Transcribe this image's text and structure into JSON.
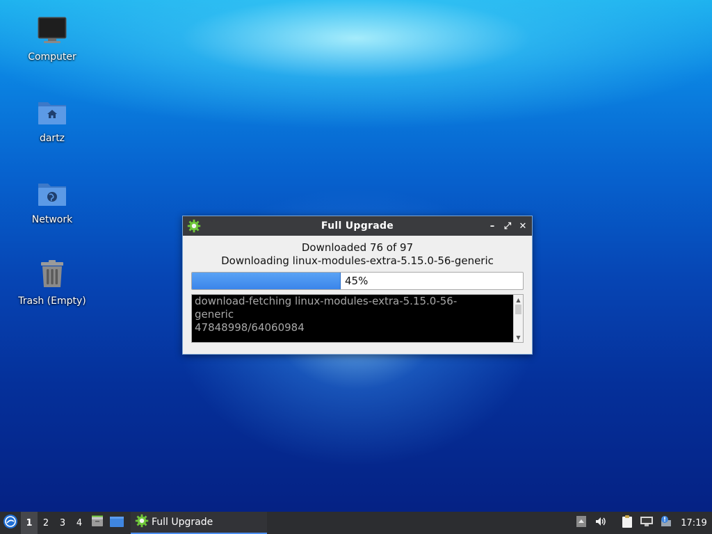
{
  "desktop": {
    "icons": [
      {
        "label": "Computer",
        "icon": "computer-icon"
      },
      {
        "label": "dartz",
        "icon": "home-folder-icon"
      },
      {
        "label": "Network",
        "icon": "network-folder-icon"
      },
      {
        "label": "Trash (Empty)",
        "icon": "trash-icon"
      }
    ]
  },
  "dialog": {
    "title": "Full Upgrade",
    "status_line1": "Downloaded 76 of 97",
    "status_line2": "Downloading linux-modules-extra-5.15.0-56-generic",
    "progress_percent": 45,
    "progress_label": "45%",
    "log_lines": [
      "download-fetching linux-modules-extra-5.15.0-56-",
      "generic",
      "47848998/64060984"
    ],
    "controls": {
      "minimize": "–",
      "maximize": "⤢",
      "close": "✕"
    }
  },
  "taskbar": {
    "workspaces": [
      "1",
      "2",
      "3",
      "4"
    ],
    "active_workspace": "1",
    "task_label": "Full Upgrade",
    "clock": "17:19"
  },
  "colors": {
    "accent": "#4c8ef0",
    "progress_fill": "#3b85ea",
    "titlebar": "#3a3b3e",
    "taskbar": "#2c2d30"
  }
}
